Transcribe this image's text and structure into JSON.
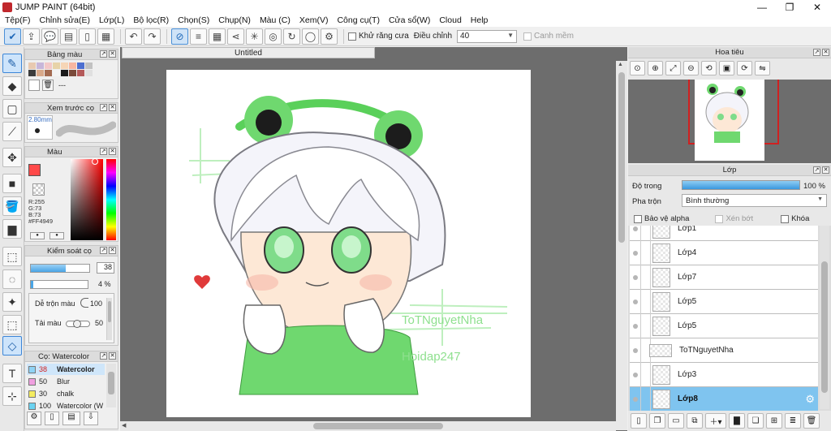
{
  "window": {
    "title": "JUMP PAINT (64bit)",
    "minimize": "—",
    "maximize": "❐",
    "close": "✕"
  },
  "menu": [
    "Tệp(F)",
    "Chỉnh sửa(E)",
    "Lớp(L)",
    "Bộ lọc(R)",
    "Chọn(S)",
    "Chụp(N)",
    "Màu (C)",
    "Xem(V)",
    "Công cụ(T)",
    "Cửa sổ(W)",
    "Cloud",
    "Help"
  ],
  "toolbar": {
    "antialias_label": "Khử răng cưa",
    "adjust_label": "Điều chỉnh",
    "adjust_value": "40",
    "edge_label": "Canh mềm"
  },
  "colors": {
    "accent": "#4a8fd6",
    "selected_layer": "#7fc4ef",
    "current_color": "#ff4949"
  },
  "left": {
    "palette_title": "Bảng màu",
    "palette_dash": "---",
    "palette_colors": [
      "#e8c9b0",
      "#c7b6d9",
      "#f3c8c8",
      "#e7d3a8",
      "#f6d5b6",
      "#f7b6a0",
      "#4d6fd0",
      "#c2c2c2",
      "#3c3c3c",
      "#d8a98a",
      "#a36a50",
      "#f3f3f3",
      "#1a1a1a",
      "#7a4a3a",
      "#b45a5a",
      "#e0e0e0"
    ],
    "preview_title": "Xem trước cọ",
    "brush_size": "2.80mm",
    "color_title": "Màu",
    "rgb": {
      "r": "R:255",
      "g": "G:73",
      "b": "B:73",
      "hex": "#FF4949"
    },
    "brush_control_title": "Kiểm soát cọ",
    "size_value": "38",
    "opacity_value": "4 %",
    "blend_label": "Dễ trộn màu",
    "blend_value": "100",
    "reload_label": "Tải màu",
    "reload_value": "50",
    "brush_list_title": "Cọ: Watercolor",
    "brushes": [
      {
        "size": "38",
        "name": "Watercolor",
        "color": "#8fd3f5",
        "selected": true
      },
      {
        "size": "50",
        "name": "Blur",
        "color": "#f0a0e0",
        "selected": false
      },
      {
        "size": "30",
        "name": "chalk",
        "color": "#f4ec60",
        "selected": false
      },
      {
        "size": "100",
        "name": "Watercolor (W",
        "color": "#6ad2f0",
        "selected": false
      }
    ]
  },
  "document": {
    "tab": "Untitled",
    "watermark1": "ToTNguyetNha",
    "watermark2": "Hoidap247"
  },
  "navigator": {
    "title": "Hoa tiêu"
  },
  "layers": {
    "title": "Lớp",
    "opacity_label": "Độ trong",
    "opacity_value": "100 %",
    "opacity": 1.0,
    "blend_label": "Pha trộn",
    "blend_value": "Bình thường",
    "protect_alpha": "Bảo vệ alpha",
    "clipping": "Xén bớt",
    "lock": "Khóa",
    "items": [
      {
        "name": "Lớp1",
        "selected": false
      },
      {
        "name": "Lớp4",
        "selected": false
      },
      {
        "name": "Lớp7",
        "selected": false
      },
      {
        "name": "Lớp5",
        "selected": false
      },
      {
        "name": "Lớp5",
        "selected": false
      },
      {
        "name": "ToTNguyetNha",
        "selected": false
      },
      {
        "name": "Lớp3",
        "selected": false
      },
      {
        "name": "Lớp8",
        "selected": true
      }
    ]
  }
}
